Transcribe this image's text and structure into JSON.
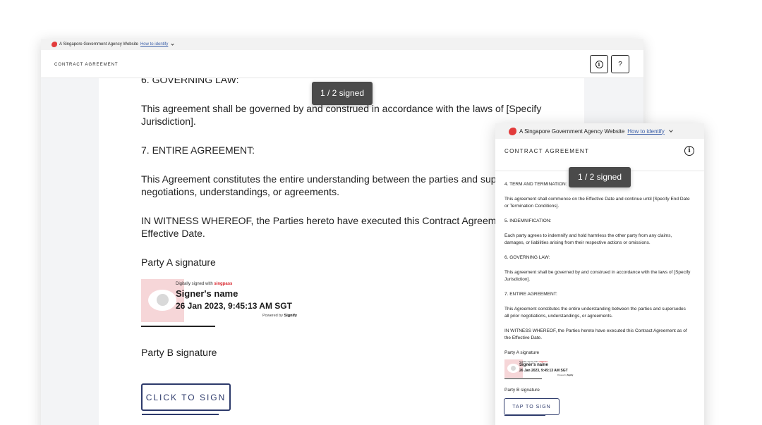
{
  "banner": {
    "text": "A Singapore Government Agency Website",
    "link": "How to identify"
  },
  "desktop": {
    "header_title": "CONTRACT AGREEMENT",
    "help_label": "?",
    "info_label": "i",
    "toast": "1 / 2 signed",
    "section_6_heading": "6. GOVERNING LAW:",
    "section_6_body": "This agreement shall be governed by and construed in accordance with the laws of [Specify Jurisdiction].",
    "section_7_heading": "7. ENTIRE AGREEMENT:",
    "section_7_body": "This Agreement constitutes the entire understanding between the parties and supersedes all prior negotiations, understandings, or agreements.",
    "witness": "IN WITNESS WHEREOF, the Parties hereto have executed this Contract Agreement as of the Effective Date.",
    "party_a_label": "Party A signature",
    "party_b_label": "Party B signature",
    "sign_button": "CLICK TO SIGN"
  },
  "signature": {
    "digitally_signed": "Digitally signed with",
    "provider": "singpass",
    "signer_name": "Signer's name",
    "timestamp": "26 Jan 2023, 9:45:13 AM SGT",
    "powered_by": "Powered by",
    "powered_brand": "Signify"
  },
  "mobile": {
    "header_title": "CONTRACT AGREEMENT",
    "toast": "1 / 2 signed",
    "section_4_heading": "4. TERM AND TERMINATION:",
    "section_4_body": "This agreement shall commence on the Effective Date and continue until [Specify End Date or Termination Conditions].",
    "section_5_heading": "5. INDEMNIFICATION:",
    "section_5_body": "Each party agrees to indemnify and hold harmless the other party from any claims, damages, or liabilities arising from their respective actions or omissions.",
    "section_6_heading": "6. GOVERNING LAW:",
    "section_6_body": "This agreement shall be governed by and construed in accordance with the laws of [Specify Jurisdiction].",
    "section_7_heading": "7. ENTIRE AGREEMENT:",
    "section_7_body": "This Agreement constitutes the entire understanding between the parties and supersedes all prior negotiations, understandings, or agreements.",
    "witness": "IN WITNESS WHEREOF, the Parties hereto have executed this Contract Agreement as of the Effective Date.",
    "party_a_label": "Party A signature",
    "party_b_label": "Party B signature",
    "sign_button": "TAP TO SIGN"
  }
}
